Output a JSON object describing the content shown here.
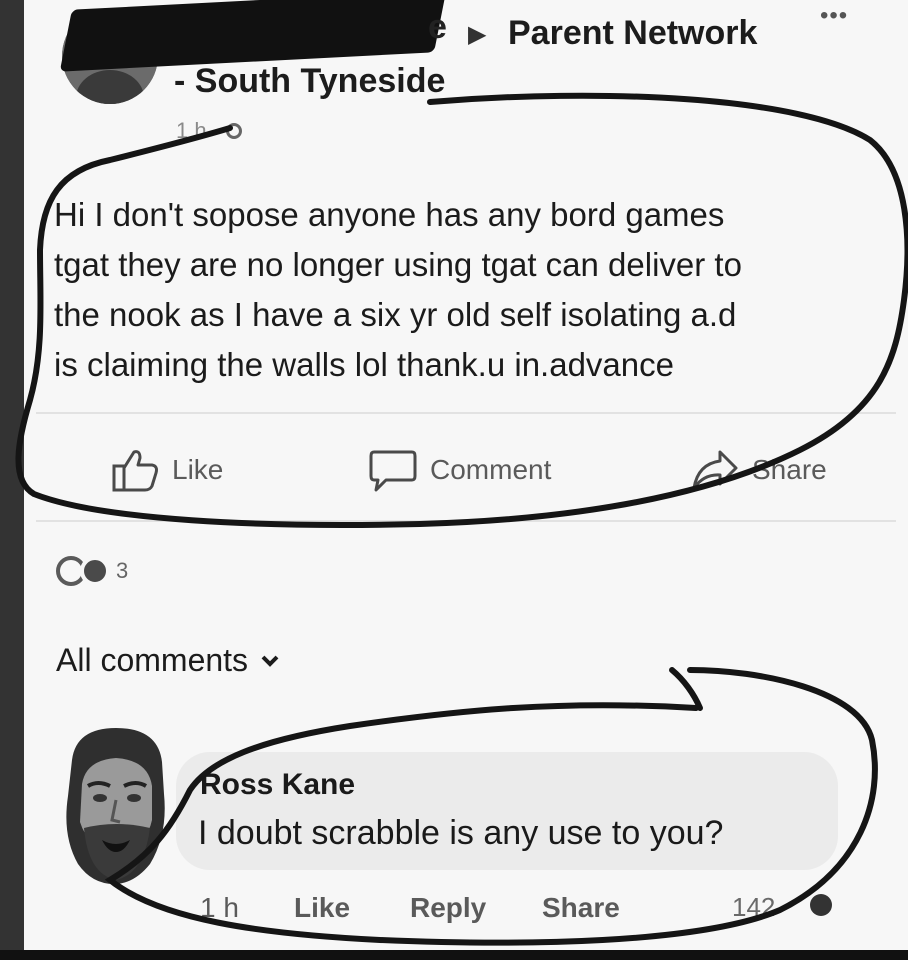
{
  "post": {
    "author_tail": "e",
    "group_line1": "Parent Network",
    "group_line2": "- South Tyneside",
    "time": "1 h ·",
    "more": "•••",
    "text_lines": [
      "Hi I don't sopose anyone has any bord games",
      "tgat they are no longer using tgat can deliver to",
      "the nook as I have a six yr old self isolating a.d",
      "is claiming the walls lol  thank.u in.advance"
    ],
    "actions": {
      "like": "Like",
      "comment": "Comment",
      "share": "Share"
    },
    "reaction_count": "3"
  },
  "comments_filter": {
    "label": "All comments"
  },
  "comment": {
    "author": "Ross Kane",
    "text": "I doubt scrabble is any use to you?",
    "time": "1 h",
    "like": "Like",
    "reply": "Reply",
    "share": "Share",
    "reaction_count": "142"
  },
  "icons": {
    "post_avatar": "profile-avatar-icon",
    "globe": "globe-icon",
    "like": "thumbs-up-icon",
    "comment": "speech-bubble-icon",
    "share": "share-arrow-icon",
    "reactions": "reaction-icons",
    "chevron": "chevron-down-icon",
    "comment_avatar": "face-avatar-icon"
  },
  "colors": {
    "background": "#f7f7f7",
    "text": "#1c1c1c",
    "secondary_text": "#5a5a5a",
    "bubble": "#ebebeb",
    "annotation_ink": "#151515"
  }
}
